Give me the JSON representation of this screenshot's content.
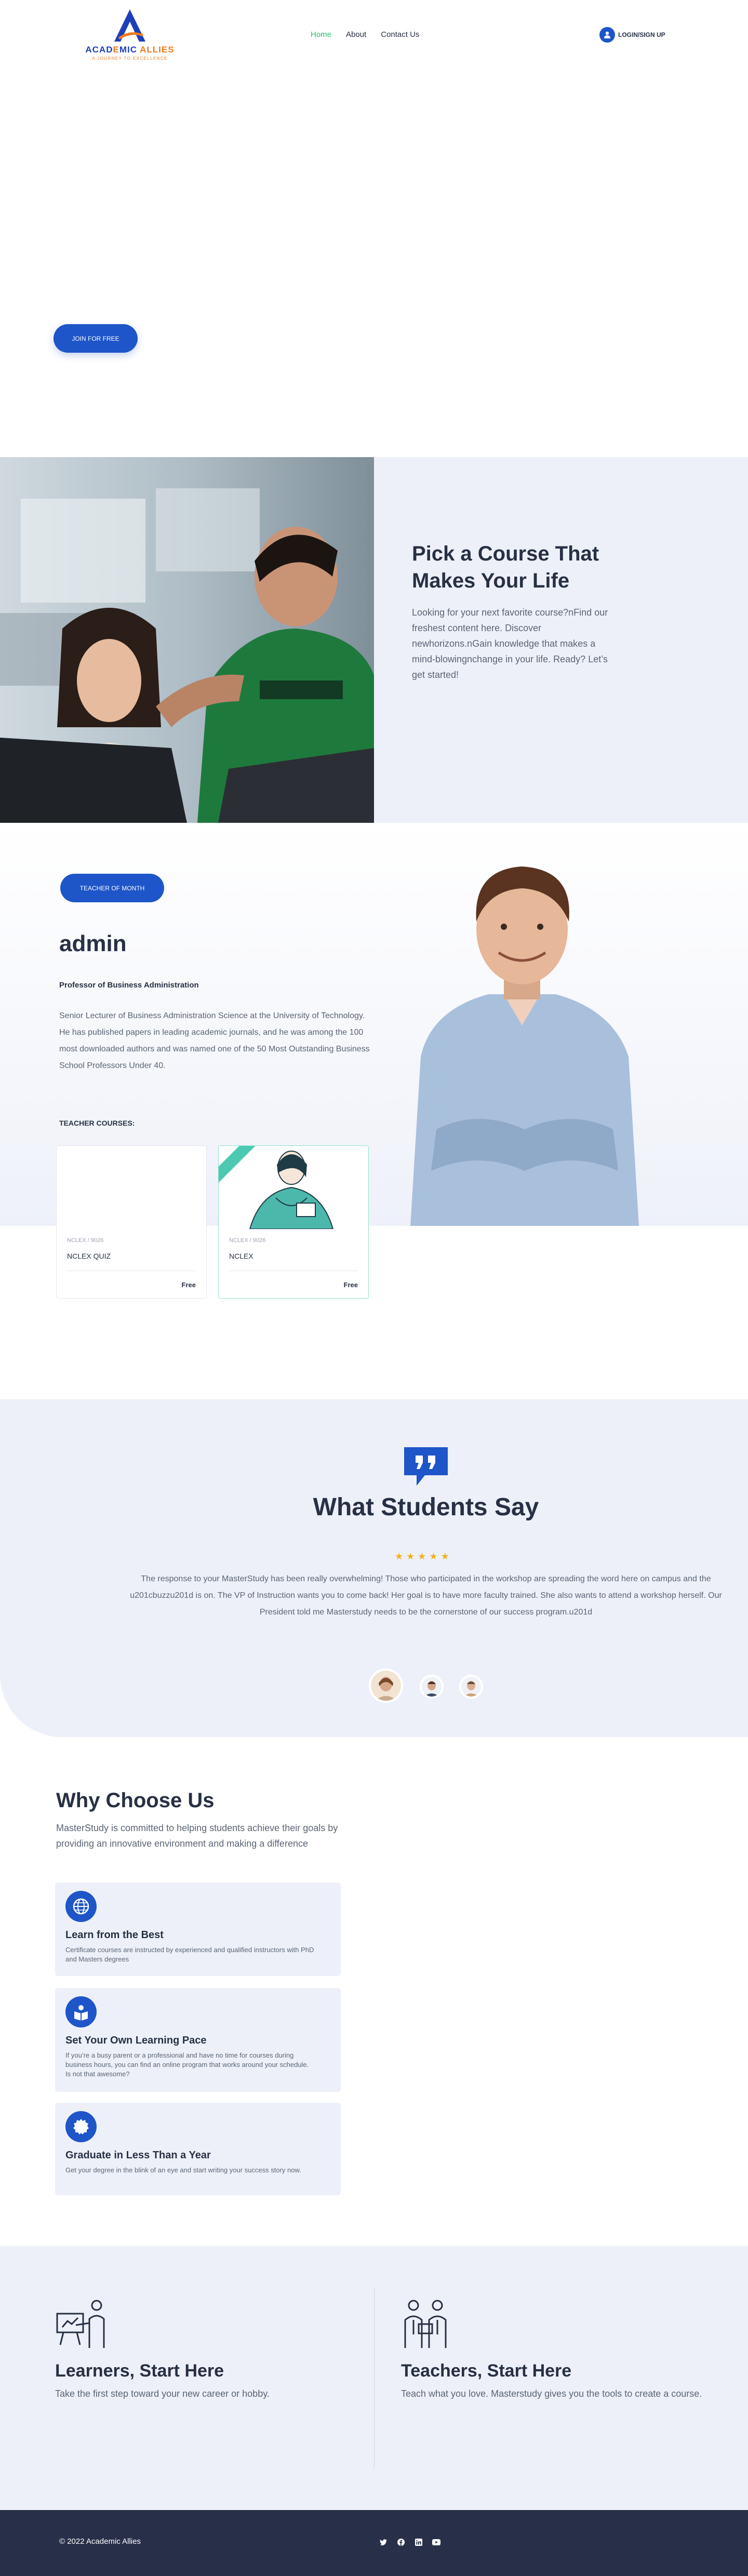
{
  "brand": {
    "name_part1": "ACAD",
    "name_accent": "E",
    "name_part2": "MIC",
    "name_part3": "ALLIES",
    "tagline": "A JOURNEY TO EXCELLENCE"
  },
  "nav": {
    "home": "Home",
    "about": "About",
    "contact": "Contact Us"
  },
  "auth": {
    "login_label": "LOGIN/SIGN UP"
  },
  "hero": {
    "join_label": "JOIN FOR FREE"
  },
  "pick": {
    "title": "Pick a Course That Makes Your Life",
    "description": "Looking for your next favorite course?nFind our freshest content here. Discover newhorizons.nGain knowledge that makes a mind-blowingnchange in your life. Ready? Let’s get started!"
  },
  "teacher": {
    "badge": "TEACHER OF MONTH",
    "name": "admin",
    "role": "Professor of Business Administration",
    "bio": "Senior Lecturer of Business Administration Science at the University of Technology. He has published papers in leading academic journals, and he was among the 100 most downloaded authors and was named one of the 50 Most Outstanding Business School Professors Under 40.",
    "courses_label": "TEACHER COURSES:",
    "courses": [
      {
        "date": "NCLEX / 9026",
        "title": "NCLEX QUIZ",
        "price": "Free"
      },
      {
        "date": "NCLEX / 9026",
        "title": "NCLEX",
        "price": "Free"
      }
    ]
  },
  "testimonials": {
    "title": "What Students Say",
    "stars": "★★★★★",
    "text": "The response to your MasterStudy has been really overwhelming! Those who participated in the workshop are spreading the word here on campus and the u201cbuzzu201d is on. The VP of Instruction wants you to come back! Her goal is to have more faculty trained. She also wants to attend a workshop herself. Our President told me Masterstudy needs to be the cornerstone of our success program.u201d"
  },
  "why": {
    "title": "Why Choose Us",
    "description": "MasterStudy is committed to helping students achieve their goals by providing an innovative environment and making a difference",
    "features": [
      {
        "title": "Learn from the Best",
        "desc": "Certificate courses are instructed by experienced and qualified instructors with PhD and Masters degrees"
      },
      {
        "title": "Set Your Own Learning Pace",
        "desc": "If you’re a busy parent or a professional and have no time for courses during business hours, you can find an online program that works around your schedule. Is not that awesome?"
      },
      {
        "title": "Graduate in Less Than a Year",
        "desc": "Get your degree in the blink of an eye and start writing your success story now."
      }
    ]
  },
  "learners": {
    "title": "Learners, Start Here",
    "desc": "Take the first step toward your new career or hobby."
  },
  "teachers": {
    "title": "Teachers, Start Here",
    "desc": "Teach what you love. Masterstudy gives you the tools to create a course."
  },
  "footer": {
    "copyright": "© 2022 Academic Allies"
  },
  "colors": {
    "primary": "#1e55c8",
    "accent": "#f07a1a",
    "green": "#2fbf71",
    "soft_bg": "#edf0f8",
    "dark": "#273048",
    "star": "#f2b01e"
  }
}
